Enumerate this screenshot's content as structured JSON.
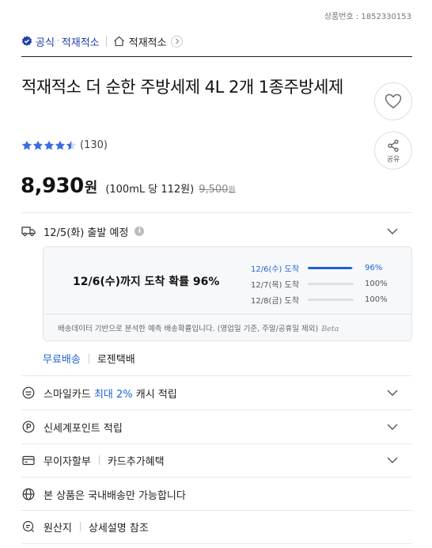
{
  "product_no": "상품번호 : 1852330153",
  "breadcrumb": {
    "official_label": "공식",
    "official_store": "적재적소",
    "store_link": "적재적소"
  },
  "title": "적재적소 더 순한 주방세제 4L 2개 1종주방세제",
  "rating": {
    "stars": 4.5,
    "count_text": "(130)"
  },
  "actions": {
    "share_label": "공유"
  },
  "price": {
    "sale": "8,930",
    "currency": "원",
    "unit_text": "(100mL 당 112원)",
    "original": "9,500",
    "original_currency": "원"
  },
  "shipping": {
    "dispatch_text": "12/5(화) 출발 예정",
    "probability_headline": "12/6(수)까지 도착 확률 96%",
    "probabilities": [
      {
        "date": "12/6(수) 도착",
        "percent_text": "96%",
        "value": 0.96
      },
      {
        "date": "12/7(목) 도착",
        "percent_text": "100%",
        "value": 1.0
      },
      {
        "date": "12/8(금) 도착",
        "percent_text": "100%",
        "value": 1.0
      }
    ],
    "footnote": "배송데이터 기반으로 분석한 예측 배송확률입니다. (영업일 기준, 주말/공휴일 제외)",
    "beta": "Beta",
    "free_label": "무료배송",
    "courier": "로젠택배"
  },
  "benefits": {
    "smile_pre": "스마일카드",
    "smile_hl": "최대 2%",
    "smile_post": "캐시 적립",
    "shinsegae": "신세계포인트 적립",
    "installment": "무이자할부",
    "card_extra": "카드추가혜택",
    "domestic": "본 상품은 국내배송만 가능합니다",
    "origin": "원산지",
    "origin_detail": "상세설명 참조"
  },
  "colors": {
    "accent": "#1e63d6",
    "brand": "#1f3fa8",
    "star": "#3a6be0"
  }
}
